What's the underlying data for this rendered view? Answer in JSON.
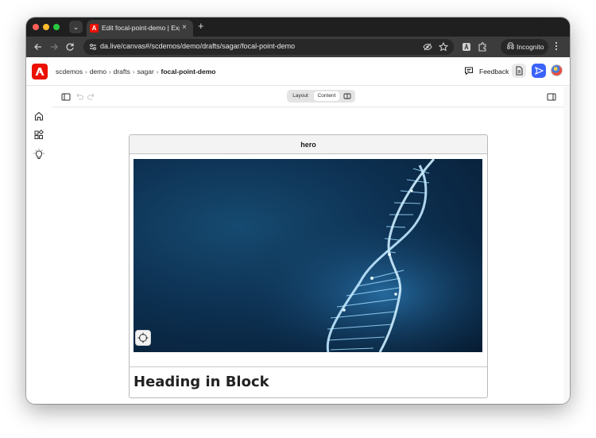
{
  "browser": {
    "tab": {
      "title": "Edit focal-point-demo | Experience Manager",
      "favicon": "adobe-icon",
      "close_glyph": "×"
    },
    "new_tab_glyph": "+",
    "url": "da.live/canvas#/scdemos/demo/drafts/sagar/focal-point-demo",
    "profile_label": "Incognito"
  },
  "app": {
    "brand_color": "#eb1000",
    "breadcrumb": [
      {
        "label": "scdemos"
      },
      {
        "label": "demo"
      },
      {
        "label": "drafts"
      },
      {
        "label": "sagar"
      },
      {
        "label": "focal-point-demo",
        "current": true
      }
    ],
    "feedback_label": "Feedback",
    "send_color": "#3b63fb"
  },
  "sidenav": {
    "items": [
      {
        "icon": "home-icon"
      },
      {
        "icon": "apps-icon"
      },
      {
        "icon": "lightbulb-icon"
      }
    ]
  },
  "editor": {
    "view_tabs": [
      {
        "label": "Layout",
        "active": false
      },
      {
        "label": "Content",
        "active": true
      }
    ],
    "block": {
      "name": "hero",
      "heading": "Heading in Block"
    }
  }
}
